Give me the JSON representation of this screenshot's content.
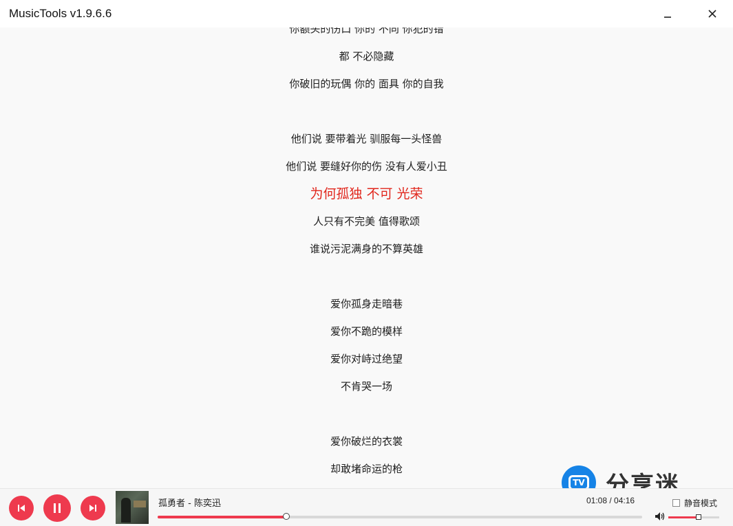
{
  "window": {
    "title": "MusicTools v1.9.6.6",
    "minimize_icon": "minimize-icon",
    "close_icon": "close-icon"
  },
  "lyrics": [
    {
      "text": "你额头的伤口 你的 不同 你犯的错",
      "active": false
    },
    {
      "text": "都 不必隐藏",
      "active": false
    },
    {
      "text": "你破旧的玩偶 你的 面具 你的自我",
      "active": false
    },
    {
      "text": "",
      "active": false
    },
    {
      "text": "他们说 要带着光 驯服每一头怪兽",
      "active": false
    },
    {
      "text": "他们说 要缝好你的伤 没有人爱小丑",
      "active": false
    },
    {
      "text": "为何孤独 不可 光荣",
      "active": true
    },
    {
      "text": "人只有不完美 值得歌颂",
      "active": false
    },
    {
      "text": "谁说污泥满身的不算英雄",
      "active": false
    },
    {
      "text": "",
      "active": false
    },
    {
      "text": "爱你孤身走暗巷",
      "active": false
    },
    {
      "text": "爱你不跪的模样",
      "active": false
    },
    {
      "text": "爱你对峙过绝望",
      "active": false
    },
    {
      "text": "不肯哭一场",
      "active": false
    },
    {
      "text": "",
      "active": false
    },
    {
      "text": "爱你破烂的衣裳",
      "active": false
    },
    {
      "text": "却敢堵命运的枪",
      "active": false
    }
  ],
  "watermark": {
    "text": "分享迷",
    "logo_text": "TV"
  },
  "player": {
    "track": "孤勇者 - 陈奕迅",
    "time": "01:08 / 04:16",
    "progress_fraction": 0.266,
    "mute_label": "静音模式",
    "muted": false,
    "volume_fraction": 0.59,
    "icons": {
      "prev": "previous-icon",
      "play": "pause-icon",
      "next": "next-icon",
      "volume": "volume-icon"
    },
    "accent_color": "#ee3a4e",
    "highlight_color": "#e1261c"
  }
}
